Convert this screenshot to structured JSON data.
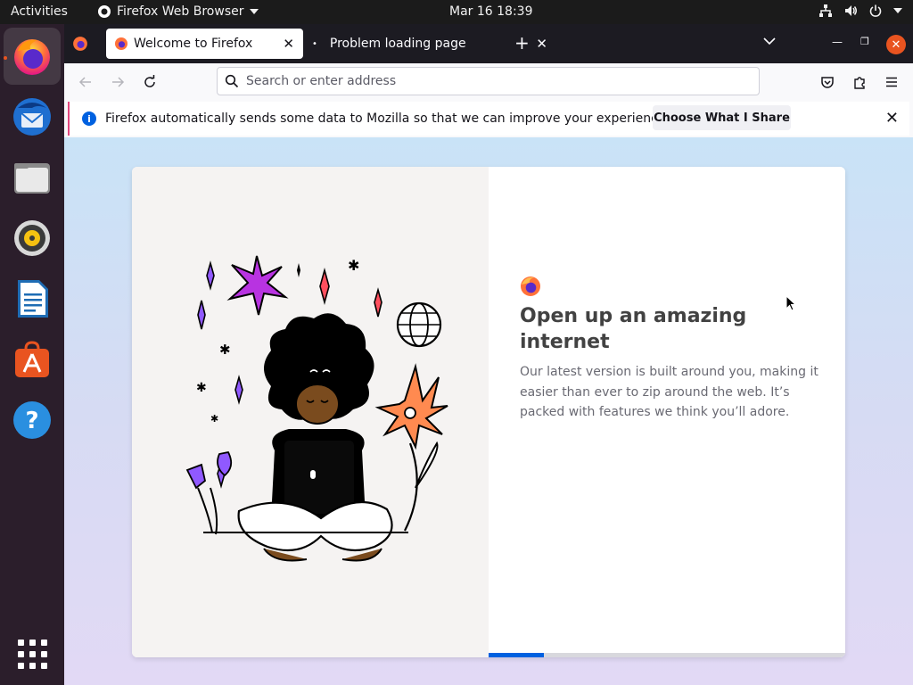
{
  "topbar": {
    "activities": "Activities",
    "app_name": "Firefox Web Browser",
    "clock": "Mar 16  18:39"
  },
  "dock": {
    "items": [
      "firefox-icon",
      "thunderbird-icon",
      "files-icon",
      "rhythmbox-icon",
      "libreoffice-writer-icon",
      "software-center-icon",
      "help-icon"
    ]
  },
  "tabs": [
    {
      "title": "Welcome to Firefox",
      "selected": true
    },
    {
      "title": "Problem loading page",
      "selected": false
    }
  ],
  "urlbar": {
    "placeholder": "Search or enter address"
  },
  "notification": {
    "message": "Firefox automatically sends some data to Mozilla so that we can improve your experience.",
    "button": "Choose What I Share"
  },
  "welcome": {
    "headline": "Open up an amazing internet",
    "subtext": "Our latest version is built around you, making it easier than ever to zip around the web. It’s packed with features we think you’ll adore.",
    "progress_fraction": 0.155
  },
  "colors": {
    "accent": "#e95420",
    "firefox_blue": "#0061e0",
    "dark_tabbar": "#1c1b22"
  }
}
